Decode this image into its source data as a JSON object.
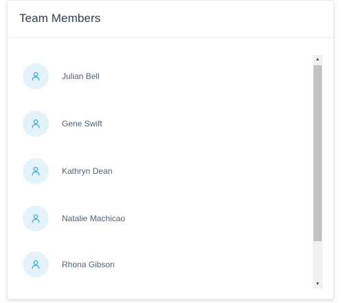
{
  "card": {
    "title": "Team Members"
  },
  "members": [
    {
      "name": "Julian Bell",
      "icon": "user-icon"
    },
    {
      "name": "Gene Swift",
      "icon": "user-icon"
    },
    {
      "name": "Kathryn Dean",
      "icon": "user-icon"
    },
    {
      "name": "Natalie Machicao",
      "icon": "user-icon"
    },
    {
      "name": "Rhona Gibson",
      "icon": "user-icon"
    }
  ],
  "scrollbar": {
    "up_glyph": "▲",
    "down_glyph": "▼"
  },
  "colors": {
    "avatar_bg": "#e4f2fb",
    "icon_stroke": "#3ba8de",
    "title_text": "#2f3a4d",
    "name_text": "#50607a"
  }
}
